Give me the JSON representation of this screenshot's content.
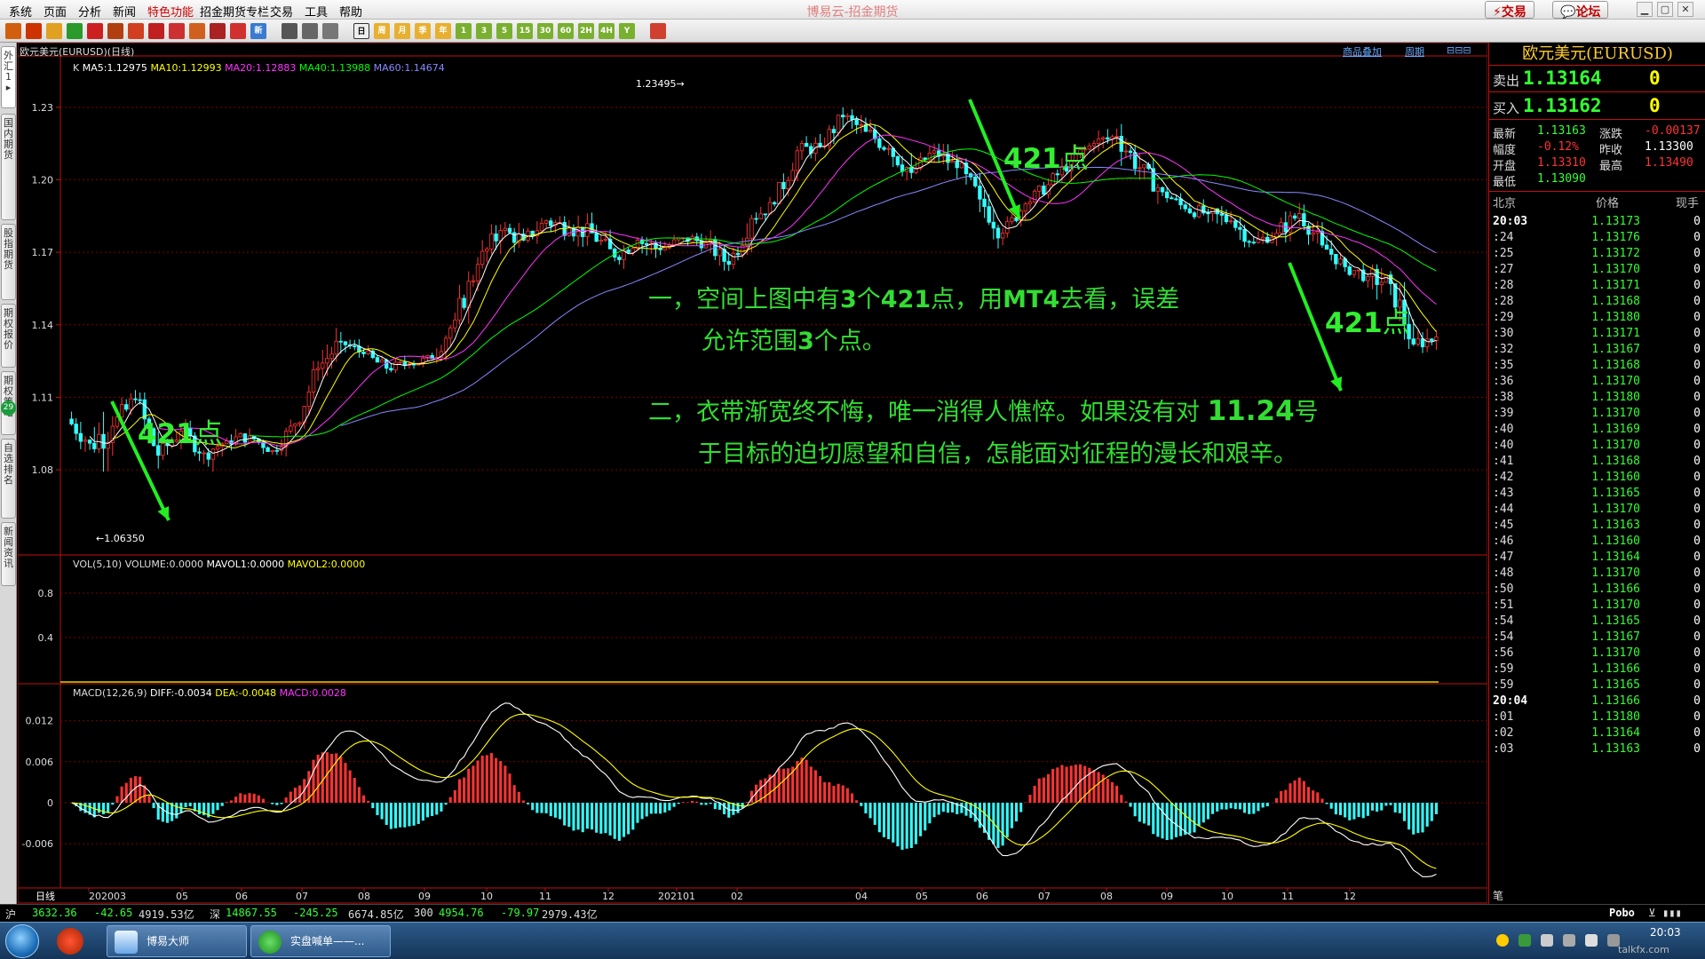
{
  "menu": [
    "系统",
    "页面",
    "分析",
    "新闻",
    "特色功能",
    "招金期货专栏",
    "交易",
    "工具",
    "帮助"
  ],
  "app_title": "博易云-招金期货",
  "top_buttons": {
    "trade": "交易",
    "forum": "论坛"
  },
  "toolbar_icons": [
    "back-icon",
    "home-icon",
    "news-icon",
    "refresh-icon",
    "window-icon",
    "search-icon",
    "search-alt-icon",
    "cut-icon",
    "draw-icon",
    "pen-icon",
    "erase-icon",
    "funnel-icon",
    "new-icon",
    "table-icon",
    "chart-icon",
    "draw-tool-icon",
    "day-icon",
    "week-icon",
    "month-icon",
    "quarter-icon",
    "year-icon",
    "1m-icon",
    "3m-icon",
    "5m-icon",
    "15m-icon",
    "30m-icon",
    "60m-icon",
    "2h-icon",
    "4h-icon",
    "custom-icon",
    "exit-icon"
  ],
  "toolbar_labels": {
    "day": "日",
    "week": "周",
    "month": "月",
    "quarter": "季",
    "year": "年",
    "1m": "1",
    "3m": "3",
    "5m": "5",
    "15m": "15",
    "30m": "30",
    "60m": "60",
    "2h": "2H",
    "4h": "4H",
    "custom": "Y",
    "new": "新"
  },
  "left_tabs": [
    "外汇1",
    "国内期货",
    "股指期货",
    "期权报价",
    "期权策略",
    "自选排名",
    "新闻资讯"
  ],
  "left_badge": "29",
  "chart_header": {
    "symbol": "欧元美元(EURUSD)(日线)",
    "add_link": "商品叠加",
    "period_link": "周期"
  },
  "price_legend": {
    "k": "K",
    "ma5": "MA5:1.12975",
    "ma10": "MA10:1.12993",
    "ma20": "MA20:1.12883",
    "ma40": "MA40:1.13988",
    "ma60": "MA60:1.14674"
  },
  "vol_legend": {
    "vol": "VOL(5,10)",
    "volume": "VOLUME:0.0000",
    "mavol1": "MAVOL1:0.0000",
    "mavol2": "MAVOL2:0.0000"
  },
  "macd_legend": {
    "macd": "MACD(12,26,9)",
    "diff": "DIFF:-0.0034",
    "dea": "DEA:-0.0048",
    "macdv": "MACD:0.0028"
  },
  "price_axis": [
    "1.23",
    "1.20",
    "1.17",
    "1.14",
    "1.11",
    "1.08"
  ],
  "vol_axis": [
    "0.8",
    "0.4"
  ],
  "macd_axis": [
    "0.012",
    "0.006",
    "0",
    "-0.006"
  ],
  "x_labels": [
    "日线",
    "202003",
    "05",
    "06",
    "07",
    "08",
    "09",
    "10",
    "11",
    "12",
    "202101",
    "02",
    "04",
    "05",
    "06",
    "07",
    "08",
    "09",
    "10",
    "11",
    "12"
  ],
  "high_label": "1.23495→",
  "low_label": "←1.06350",
  "annotations": {
    "line1a": "一，空间上图中有",
    "line1b": "3",
    "line1c": "个",
    "line1d": "421",
    "line1e": "点，用",
    "line1f": "MT4",
    "line1g": "去看，误差",
    "line2a": "允许范围",
    "line2b": "3",
    "line2c": "个点。",
    "line3a": "二，衣带渐宽终不悔，唯一消得人憔悴。如果没有对 ",
    "line3b": "11.24",
    "line3c": "号",
    "line4": "于目标的迫切愿望和自信，怎能面对征程的漫长和艰辛。",
    "mark_num": "421",
    "mark_unit": "点"
  },
  "colors": {
    "up": "#ff3333",
    "down": "#33ffff",
    "ma5": "#ffffff",
    "ma10": "#ffff00",
    "ma20": "#ff33ff",
    "ma40": "#00ff00",
    "ma60": "#8888ff",
    "arrow": "#22ee22"
  },
  "chart_data": {
    "type": "candlestick",
    "symbol": "EURUSD",
    "period": "daily",
    "ylim": [
      1.055,
      1.245
    ],
    "series_high": 1.23495,
    "series_low": 1.0635,
    "ohlc_weekly_approx": [
      [
        1.101,
        1.106,
        1.084,
        1.091
      ],
      [
        1.091,
        1.104,
        1.064,
        1.098
      ],
      [
        1.098,
        1.113,
        1.086,
        1.109
      ],
      [
        1.109,
        1.112,
        1.078,
        1.086
      ],
      [
        1.086,
        1.099,
        1.081,
        1.096
      ],
      [
        1.096,
        1.101,
        1.082,
        1.087
      ],
      [
        1.087,
        1.097,
        1.076,
        1.092
      ],
      [
        1.092,
        1.102,
        1.087,
        1.094
      ],
      [
        1.094,
        1.097,
        1.084,
        1.088
      ],
      [
        1.088,
        1.102,
        1.085,
        1.099
      ],
      [
        1.099,
        1.125,
        1.097,
        1.122
      ],
      [
        1.122,
        1.142,
        1.118,
        1.133
      ],
      [
        1.133,
        1.136,
        1.123,
        1.128
      ],
      [
        1.128,
        1.133,
        1.119,
        1.122
      ],
      [
        1.122,
        1.131,
        1.119,
        1.124
      ],
      [
        1.124,
        1.132,
        1.12,
        1.126
      ],
      [
        1.126,
        1.145,
        1.124,
        1.142
      ],
      [
        1.142,
        1.168,
        1.14,
        1.165
      ],
      [
        1.165,
        1.188,
        1.162,
        1.179
      ],
      [
        1.179,
        1.19,
        1.17,
        1.175
      ],
      [
        1.175,
        1.188,
        1.172,
        1.183
      ],
      [
        1.183,
        1.196,
        1.175,
        1.18
      ],
      [
        1.18,
        1.19,
        1.17,
        1.178
      ],
      [
        1.178,
        1.182,
        1.16,
        1.168
      ],
      [
        1.168,
        1.178,
        1.162,
        1.175
      ],
      [
        1.175,
        1.183,
        1.163,
        1.171
      ],
      [
        1.171,
        1.18,
        1.168,
        1.176
      ],
      [
        1.176,
        1.183,
        1.168,
        1.174
      ],
      [
        1.174,
        1.181,
        1.162,
        1.165
      ],
      [
        1.165,
        1.188,
        1.163,
        1.184
      ],
      [
        1.184,
        1.194,
        1.18,
        1.19
      ],
      [
        1.19,
        1.214,
        1.188,
        1.212
      ],
      [
        1.212,
        1.222,
        1.205,
        1.214
      ],
      [
        1.214,
        1.23,
        1.21,
        1.226
      ],
      [
        1.226,
        1.235,
        1.216,
        1.22
      ],
      [
        1.22,
        1.225,
        1.205,
        1.213
      ],
      [
        1.213,
        1.22,
        1.195,
        1.203
      ],
      [
        1.203,
        1.215,
        1.198,
        1.212
      ],
      [
        1.212,
        1.218,
        1.2,
        1.205
      ],
      [
        1.205,
        1.212,
        1.185,
        1.192
      ],
      [
        1.192,
        1.198,
        1.17,
        1.178
      ],
      [
        1.178,
        1.192,
        1.176,
        1.19
      ],
      [
        1.19,
        1.202,
        1.186,
        1.198
      ],
      [
        1.198,
        1.212,
        1.195,
        1.208
      ],
      [
        1.208,
        1.218,
        1.2,
        1.215
      ],
      [
        1.215,
        1.228,
        1.21,
        1.218
      ],
      [
        1.218,
        1.226,
        1.2,
        1.205
      ],
      [
        1.205,
        1.21,
        1.188,
        1.195
      ],
      [
        1.195,
        1.197,
        1.183,
        1.188
      ],
      [
        1.188,
        1.195,
        1.18,
        1.186
      ],
      [
        1.186,
        1.196,
        1.178,
        1.183
      ],
      [
        1.183,
        1.186,
        1.168,
        1.174
      ],
      [
        1.174,
        1.18,
        1.166,
        1.178
      ],
      [
        1.178,
        1.192,
        1.172,
        1.186
      ],
      [
        1.186,
        1.19,
        1.17,
        1.173
      ],
      [
        1.173,
        1.178,
        1.162,
        1.164
      ],
      [
        1.164,
        1.168,
        1.152,
        1.16
      ],
      [
        1.16,
        1.165,
        1.14,
        1.157
      ],
      [
        1.157,
        1.164,
        1.13,
        1.132
      ],
      [
        1.132,
        1.14,
        1.121,
        1.135
      ]
    ]
  },
  "quote": {
    "title": "欧元美元(EURUSD)",
    "sell_label": "卖出",
    "sell": "1.13164",
    "sell_size": "0",
    "buy_label": "买入",
    "buy": "1.13162",
    "buy_size": "0",
    "stats": [
      {
        "k1": "最新",
        "v1": "1.13163",
        "k2": "涨跌",
        "v2": "-0.00137"
      },
      {
        "k1": "幅度",
        "v1": "-0.12%",
        "k2": "昨收",
        "v2": "1.13300"
      },
      {
        "k1": "开盘",
        "v1": "1.13310",
        "k2": "最高",
        "v2": "1.13490"
      },
      {
        "k1": "最低",
        "v1": "1.13090",
        "k2": "",
        "v2": ""
      }
    ],
    "ticks_head": {
      "time": "北京",
      "price": "价格",
      "vol": "现手"
    },
    "ticks": [
      [
        "20:03",
        "1.13173",
        "0"
      ],
      [
        ":24",
        "1.13176",
        "0"
      ],
      [
        ":25",
        "1.13172",
        "0"
      ],
      [
        ":27",
        "1.13170",
        "0"
      ],
      [
        ":28",
        "1.13171",
        "0"
      ],
      [
        ":28",
        "1.13168",
        "0"
      ],
      [
        ":29",
        "1.13180",
        "0"
      ],
      [
        ":30",
        "1.13171",
        "0"
      ],
      [
        ":32",
        "1.13167",
        "0"
      ],
      [
        ":35",
        "1.13168",
        "0"
      ],
      [
        ":36",
        "1.13170",
        "0"
      ],
      [
        ":38",
        "1.13180",
        "0"
      ],
      [
        ":39",
        "1.13170",
        "0"
      ],
      [
        ":40",
        "1.13169",
        "0"
      ],
      [
        ":40",
        "1.13170",
        "0"
      ],
      [
        ":41",
        "1.13168",
        "0"
      ],
      [
        ":42",
        "1.13160",
        "0"
      ],
      [
        ":43",
        "1.13165",
        "0"
      ],
      [
        ":44",
        "1.13170",
        "0"
      ],
      [
        ":45",
        "1.13163",
        "0"
      ],
      [
        ":46",
        "1.13160",
        "0"
      ],
      [
        ":47",
        "1.13164",
        "0"
      ],
      [
        ":48",
        "1.13170",
        "0"
      ],
      [
        ":50",
        "1.13166",
        "0"
      ],
      [
        ":51",
        "1.13170",
        "0"
      ],
      [
        ":54",
        "1.13165",
        "0"
      ],
      [
        ":54",
        "1.13167",
        "0"
      ],
      [
        ":56",
        "1.13170",
        "0"
      ],
      [
        ":59",
        "1.13166",
        "0"
      ],
      [
        ":59",
        "1.13165",
        "0"
      ],
      [
        "20:04",
        "1.13166",
        "0"
      ],
      [
        ":01",
        "1.13180",
        "0"
      ],
      [
        ":02",
        "1.13164",
        "0"
      ],
      [
        ":03",
        "1.13163",
        "0"
      ]
    ],
    "footer": "笔"
  },
  "status": {
    "sh_label": "沪",
    "sh": "3632.36",
    "sh_chg": "-42.65",
    "sh_amt": "4919.53亿",
    "sz_label": "深",
    "sz": "14867.55",
    "sz_chg": "-245.25",
    "sz_amt": "6674.85亿",
    "c300_label": "300",
    "c300": "4954.76",
    "c300_chg": "-79.97",
    "c300_amt": "2979.43亿",
    "brand": "Pobo"
  },
  "taskbar": {
    "task1": "博易大师",
    "task2": "实盘喊单——...",
    "clock": "20:03",
    "watermark": "talkfx.com"
  }
}
